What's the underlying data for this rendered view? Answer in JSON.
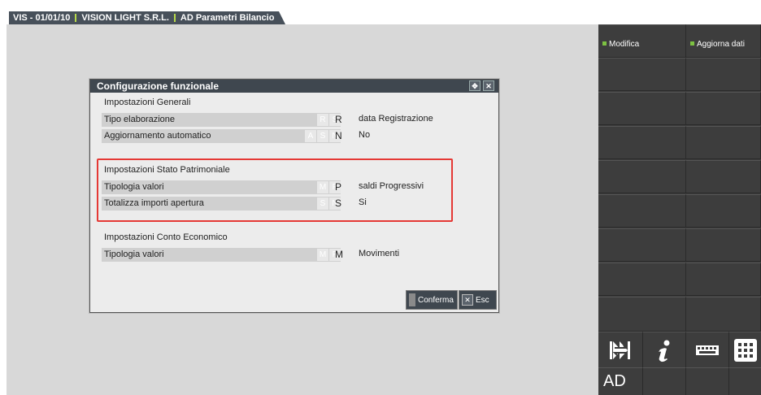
{
  "titlebar": {
    "program": "VIS - 01/01/10",
    "company": "VISION LIGHT S.R.L.",
    "module": "AD Parametri Bilancio"
  },
  "right_panel": {
    "modifica": "Modifica",
    "aggiorna": "Aggiorna dati",
    "ad_label": "AD",
    "indicator_color": "#7dc242"
  },
  "dialog": {
    "title": "Configurazione funzionale",
    "sections": [
      {
        "title": "Impostazioni Generali",
        "rows": [
          {
            "label": "Tipo elaborazione",
            "options": [
              "R",
              "S"
            ],
            "value": "R",
            "desc": "data Registrazione"
          },
          {
            "label": "Aggiornamento automatico",
            "options": [
              "A",
              "S",
              "N"
            ],
            "value": "N",
            "desc": "No"
          }
        ]
      },
      {
        "title": "Impostazioni Stato Patrimoniale",
        "rows": [
          {
            "label": "Tipologia valori",
            "options": [
              "M",
              "P"
            ],
            "value": "P",
            "desc": "saldi Progressivi"
          },
          {
            "label": "Totalizza importi apertura",
            "options": [
              "S",
              "N"
            ],
            "value": "S",
            "desc": "Si"
          }
        ]
      },
      {
        "title": "Impostazioni Conto Economico",
        "rows": [
          {
            "label": "Tipologia valori",
            "options": [
              "M",
              "P"
            ],
            "value": "M",
            "desc": "Movimenti"
          }
        ]
      }
    ],
    "confirm_label": "Conferma",
    "exit_label": "Esc",
    "highlight_color": "#e53935"
  }
}
